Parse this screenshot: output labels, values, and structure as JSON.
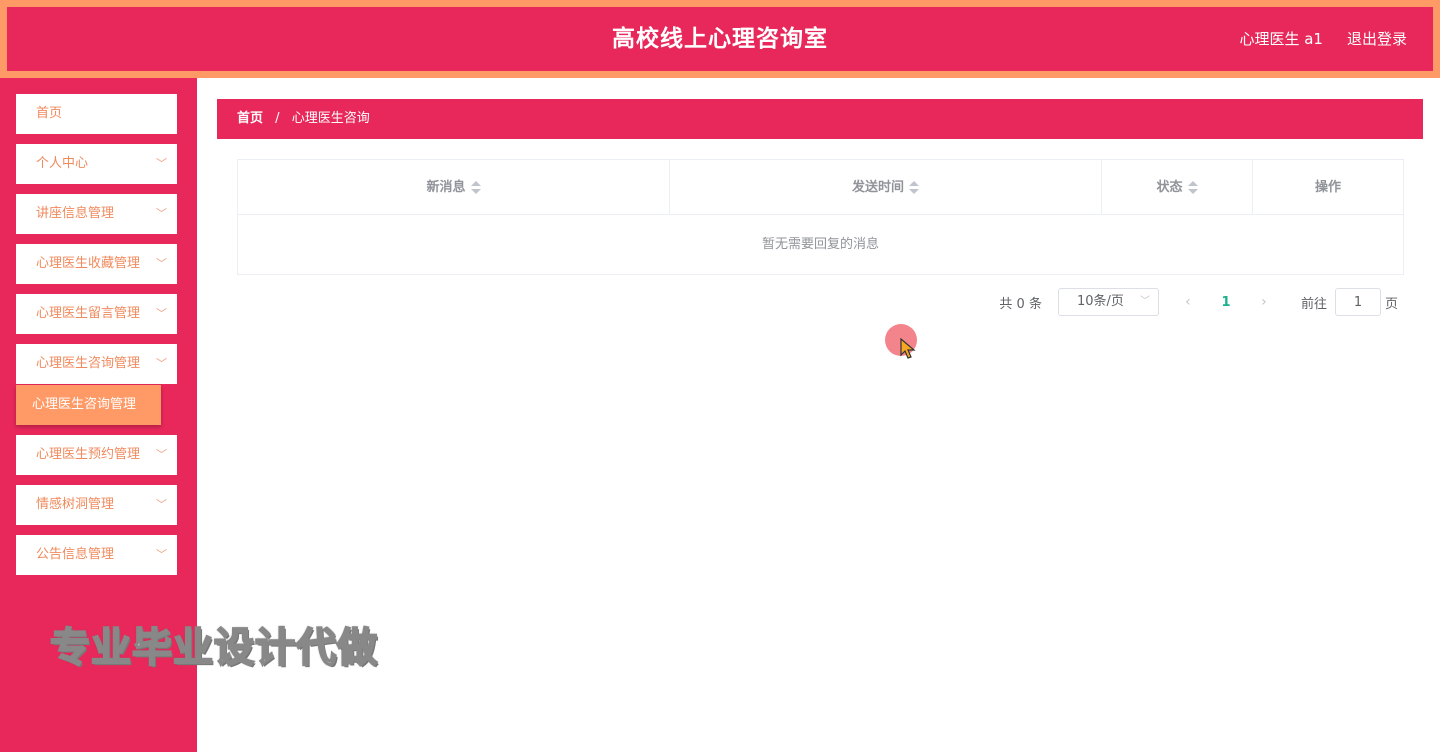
{
  "header": {
    "title": "高校线上心理咨询室",
    "user": "心理医生 a1",
    "logout": "退出登录"
  },
  "sidebar": {
    "items": [
      {
        "label": "首页",
        "has_children": false
      },
      {
        "label": "个人中心",
        "has_children": true
      },
      {
        "label": "讲座信息管理",
        "has_children": true
      },
      {
        "label": "心理医生收藏管理",
        "has_children": true
      },
      {
        "label": "心理医生留言管理",
        "has_children": true
      },
      {
        "label": "心理医生咨询管理",
        "has_children": true
      },
      {
        "label": "心理医生预约管理",
        "has_children": true
      },
      {
        "label": "情感树洞管理",
        "has_children": true
      },
      {
        "label": "公告信息管理",
        "has_children": true
      }
    ],
    "active_submenu": "心理医生咨询管理"
  },
  "breadcrumb": {
    "home": "首页",
    "separator": "/",
    "current": "心理医生咨询"
  },
  "table": {
    "columns": [
      "新消息",
      "发送时间",
      "状态",
      "操作"
    ],
    "empty_text": "暂无需要回复的消息"
  },
  "pagination": {
    "total": "共 0 条",
    "page_size": "10条/页",
    "current_page": "1",
    "goto_label": "前往",
    "goto_value": "1",
    "page_suffix": "页"
  },
  "watermark": "专业毕业设计代做",
  "icons": {
    "chevron": "chevron-down-icon",
    "sort": "sort-icon",
    "prev": "chevron-left-icon",
    "next": "chevron-right-icon"
  },
  "colors": {
    "primary": "#e8285a",
    "accent": "#ff9966",
    "page_active": "#1db08a"
  }
}
